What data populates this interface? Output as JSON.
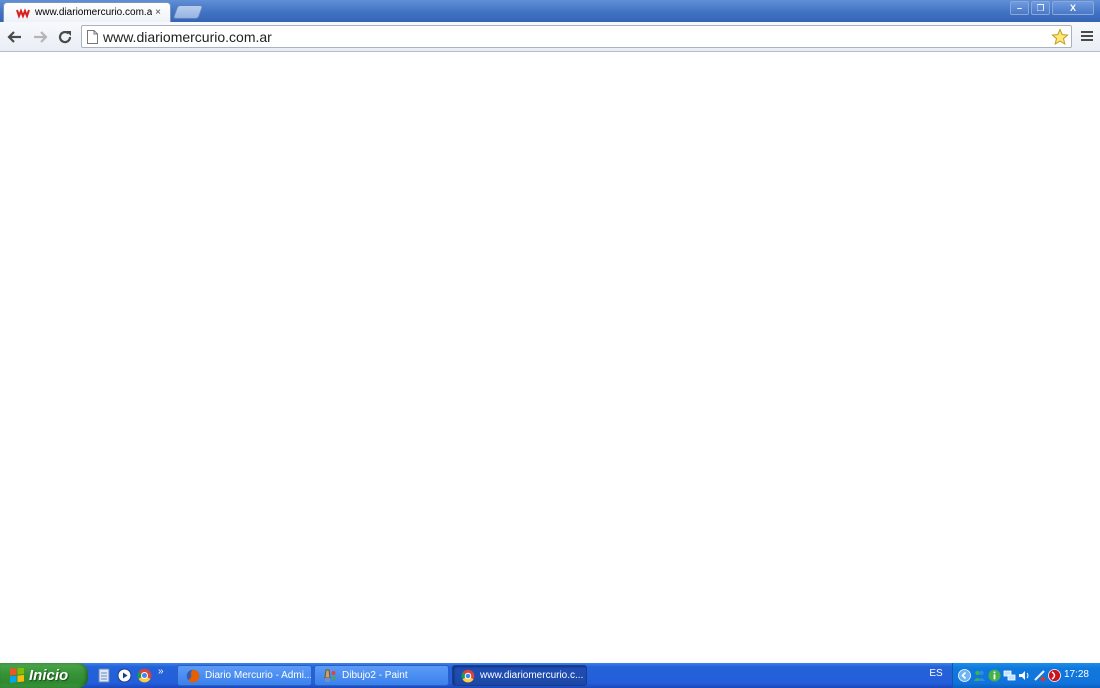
{
  "browser": {
    "tab": {
      "title": "www.diariomercurio.com.ar",
      "close": "×"
    },
    "window_controls": {
      "minimize": "–",
      "restore": "❐",
      "close": "X"
    },
    "url": "www.diariomercurio.com.ar"
  },
  "taskbar": {
    "start_label": "Inicio",
    "quicklaunch_more": "»",
    "buttons": [
      {
        "label": "Diario Mercurio - Admi...",
        "icon": "firefox-icon",
        "active": false
      },
      {
        "label": "Dibujo2 - Paint",
        "icon": "paint-icon",
        "active": false
      },
      {
        "label": "www.diariomercurio.c...",
        "icon": "chrome-icon",
        "active": true
      }
    ],
    "language": "ES",
    "clock": "17:28"
  },
  "colors": {
    "titlebar": "#3f70c2",
    "taskbar": "#245edb",
    "start_button": "#379437",
    "tray": "#0f79dd"
  }
}
